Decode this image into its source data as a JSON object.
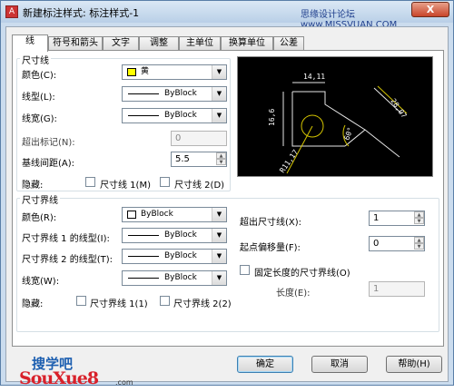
{
  "window": {
    "title": "新建标注样式: 标注样式-1",
    "watermark": "思缘设计论坛 www.MISSVUAN.COM",
    "close_label": "X"
  },
  "tabs": [
    {
      "label": "线"
    },
    {
      "label": "符号和箭头"
    },
    {
      "label": "文字"
    },
    {
      "label": "调整"
    },
    {
      "label": "主单位"
    },
    {
      "label": "换算单位"
    },
    {
      "label": "公差"
    }
  ],
  "dim_lines": {
    "group_title": "尺寸线",
    "color_label": "颜色(C):",
    "color_value": "黄",
    "color_swatch": "#ffff00",
    "linetype_label": "线型(L):",
    "linetype_value": "ByBlock",
    "lineweight_label": "线宽(G):",
    "lineweight_value": "ByBlock",
    "extend_ticks_label": "超出标记(N):",
    "extend_ticks_value": "0",
    "baseline_spacing_label": "基线间距(A):",
    "baseline_spacing_value": "5.5",
    "suppress_label": "隐藏:",
    "suppress_1": "尺寸线 1(M)",
    "suppress_2": "尺寸线 2(D)"
  },
  "ext_lines": {
    "group_title": "尺寸界线",
    "color_label": "颜色(R):",
    "color_value": "ByBlock",
    "linetype1_label": "尺寸界线 1 的线型(I):",
    "linetype1_value": "ByBlock",
    "linetype2_label": "尺寸界线 2 的线型(T):",
    "linetype2_value": "ByBlock",
    "lineweight_label": "线宽(W):",
    "lineweight_value": "ByBlock",
    "suppress_label": "隐藏:",
    "suppress_1": "尺寸界线 1(1)",
    "suppress_2": "尺寸界线 2(2)",
    "extend_beyond_label": "超出尺寸线(X):",
    "extend_beyond_value": "1",
    "offset_label": "起点偏移量(F):",
    "offset_value": "0",
    "fixed_length_label": "固定长度的尺寸界线(O)",
    "length_label": "长度(E):",
    "length_value": "1"
  },
  "preview": {
    "d1": "14,11",
    "d2": "16,6",
    "d3": "28,07",
    "angle": "60°",
    "radius": "R11,17"
  },
  "buttons": {
    "ok": "确定",
    "cancel": "取消",
    "help": "帮助(H)"
  },
  "logo": {
    "line1": "搜学吧",
    "line2": "SouXue8",
    "suffix": ".com"
  }
}
